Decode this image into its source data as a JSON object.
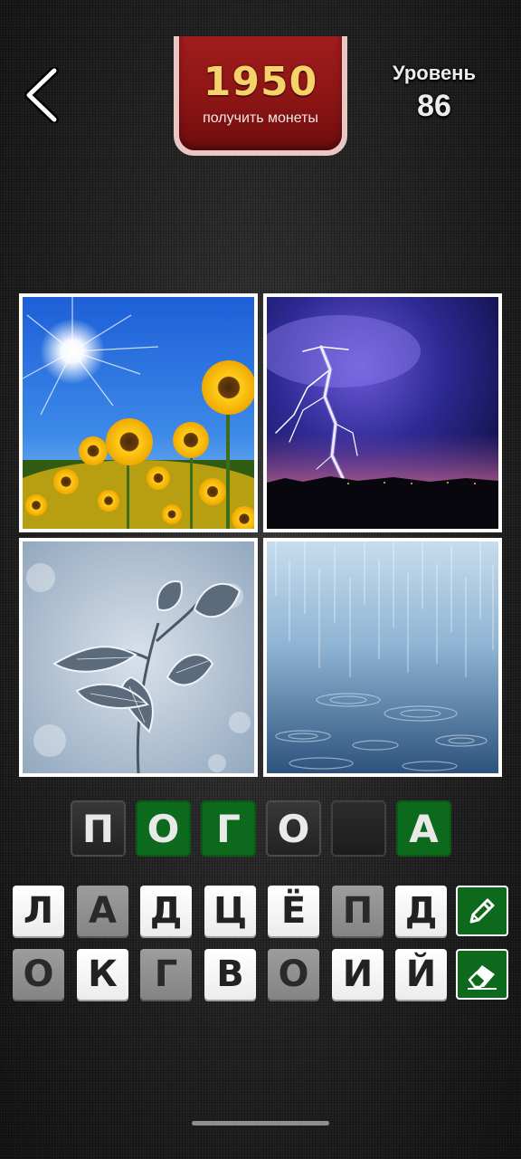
{
  "header": {
    "back_icon": "chevron-left-icon",
    "coins": "1950",
    "coins_label": "получить монеты",
    "level_label": "Уровень",
    "level_number": "86"
  },
  "pictures": [
    {
      "name": "sunflowers-sun"
    },
    {
      "name": "lightning-night"
    },
    {
      "name": "frosted-leaves"
    },
    {
      "name": "rain"
    }
  ],
  "answer": {
    "slots": [
      {
        "letter": "П",
        "style": "dark"
      },
      {
        "letter": "О",
        "style": "green"
      },
      {
        "letter": "Г",
        "style": "green"
      },
      {
        "letter": "О",
        "style": "dark"
      },
      {
        "letter": "",
        "style": "empty"
      },
      {
        "letter": "А",
        "style": "green"
      }
    ]
  },
  "keyboard": {
    "row1": [
      {
        "letter": "Л",
        "style": "light"
      },
      {
        "letter": "А",
        "style": "gray"
      },
      {
        "letter": "Д",
        "style": "light"
      },
      {
        "letter": "Ц",
        "style": "light"
      },
      {
        "letter": "Ё",
        "style": "light"
      },
      {
        "letter": "П",
        "style": "gray"
      },
      {
        "letter": "Д",
        "style": "light"
      }
    ],
    "row2": [
      {
        "letter": "О",
        "style": "gray"
      },
      {
        "letter": "К",
        "style": "light"
      },
      {
        "letter": "Г",
        "style": "gray"
      },
      {
        "letter": "В",
        "style": "light"
      },
      {
        "letter": "О",
        "style": "gray"
      },
      {
        "letter": "И",
        "style": "light"
      },
      {
        "letter": "Й",
        "style": "light"
      }
    ],
    "tools": [
      {
        "icon": "pencil-icon"
      },
      {
        "icon": "eraser-icon"
      }
    ]
  },
  "colors": {
    "accent_green": "#0d6a1c",
    "coin_red": "#8c1515",
    "coin_gold": "#f3d36a"
  }
}
